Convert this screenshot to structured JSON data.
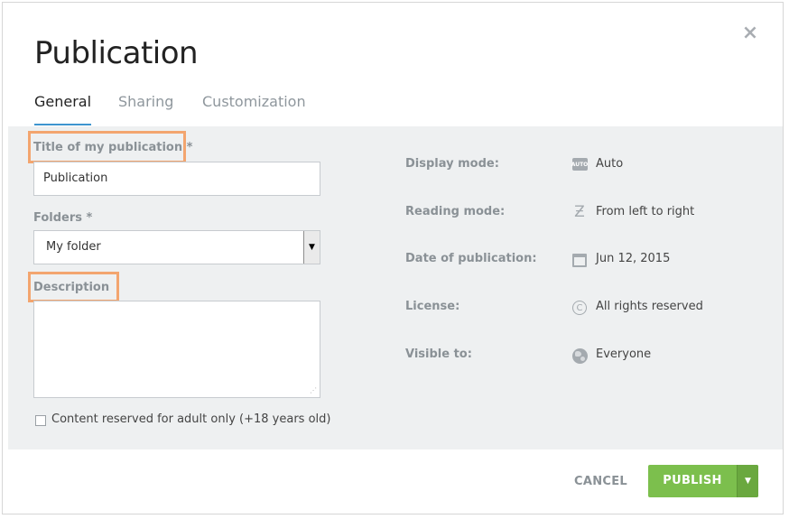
{
  "dialog": {
    "title": "Publication",
    "close_label": "×"
  },
  "tabs": [
    {
      "label": "General",
      "active": true
    },
    {
      "label": "Sharing",
      "active": false
    },
    {
      "label": "Customization",
      "active": false
    }
  ],
  "form": {
    "title_label": "Title of my publication *",
    "title_value": "Publication",
    "folders_label": "Folders *",
    "folders_value": "My folder",
    "description_label": "Description",
    "description_value": "",
    "adult_checkbox_label": "Content reserved for adult only (+18 years old)",
    "adult_checked": false
  },
  "properties": [
    {
      "label": "Display mode:",
      "value": "Auto",
      "icon": "auto-icon"
    },
    {
      "label": "Reading mode:",
      "value": "From left to right",
      "icon": "reading-direction-icon"
    },
    {
      "label": "Date of publication:",
      "value": "Jun 12, 2015",
      "icon": "calendar-icon"
    },
    {
      "label": "License:",
      "value": "All rights reserved",
      "icon": "copyright-icon"
    },
    {
      "label": "Visible to:",
      "value": "Everyone",
      "icon": "globe-icon"
    }
  ],
  "footer": {
    "cancel_label": "CANCEL",
    "publish_label": "PUBLISH"
  },
  "colors": {
    "accent_tab": "#3e95cf",
    "publish_green": "#7cbf4d",
    "highlight_orange": "#f3a56f",
    "panel_bg": "#eef0f1"
  }
}
